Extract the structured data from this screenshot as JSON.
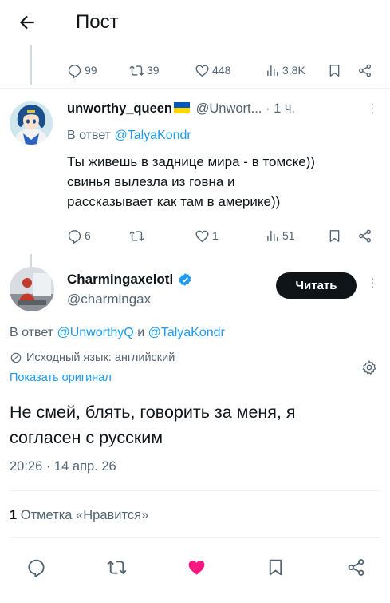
{
  "header": {
    "title": "Пост"
  },
  "parent_tweet_actions": {
    "replies": "99",
    "retweets": "39",
    "likes": "448",
    "views": "3,8K"
  },
  "reply_tweet": {
    "username": "unworthy_queen",
    "handle": "@Unwort...",
    "time": "· 1 ч.",
    "replying_prefix": "В ответ",
    "replying_to": "@TalyaKondr",
    "text_line1": "Ты живешь в заднице мира - в томске))",
    "text_line2": "свинья вылезла из говна и",
    "text_line3": "рассказывает как там в америке))",
    "actions": {
      "replies": "6",
      "likes": "1",
      "views": "51"
    }
  },
  "main_tweet": {
    "username": "Charmingaxelotl",
    "handle": "@charmingax",
    "follow_label": "Читать",
    "replying_prefix": "В ответ",
    "replying_to_1": "@UnworthyQ",
    "replying_and": "и",
    "replying_to_2": "@TalyaKondr",
    "translated_note": "Исходный язык: английский",
    "show_original": "Показать оригинал",
    "text_line1": "Не смей, блять, говорить за меня, я",
    "text_line2": "согласен с русским",
    "timestamp": "20:26 · 14 апр. 26",
    "likes_count": "1",
    "likes_label": "Отметка «Нравится»"
  },
  "colors": {
    "accent": "#1d9bf0",
    "text": "#0f1419",
    "muted": "#536471",
    "like_active": "#f91880",
    "verified": "#1d9bf0"
  }
}
